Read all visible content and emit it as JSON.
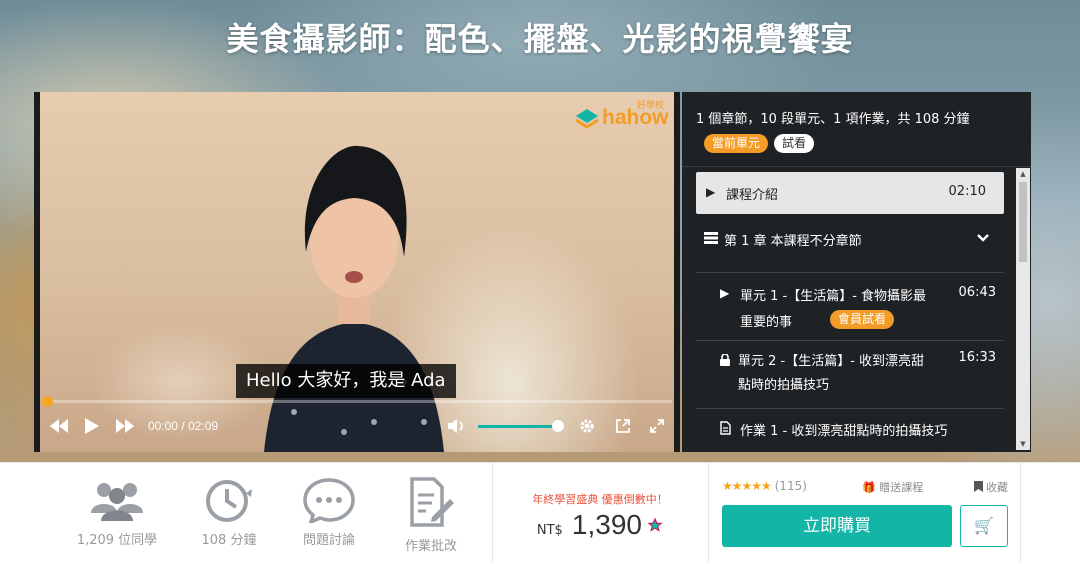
{
  "page": {
    "title": "美食攝影師：配色、擺盤、光影的視覺饗宴"
  },
  "player": {
    "logo_text": "hahow",
    "logo_sub": "好學校",
    "subtitle": "Hello 大家好，我是 Ada",
    "current_time": "00:00",
    "time_separator": "/",
    "total_time": "02:09",
    "progress": 0.0,
    "volume": 1.0
  },
  "outline": {
    "summary": "1 個章節，10 段單元、1 項作業，共 108 分鐘",
    "badge_current": "當前單元",
    "badge_trial": "試看",
    "intro": {
      "label": "課程介紹",
      "duration": "02:10"
    },
    "chapter": {
      "label": "第 1 章 本課程不分章節"
    },
    "unit1": {
      "title_line1": "單元 1 -【生活篇】- 食物攝影最",
      "title_line2": "重要的事",
      "badge": "會員試看",
      "duration": "06:43"
    },
    "unit2": {
      "title_line1": "單元 2 -【生活篇】- 收到漂亮甜",
      "title_line2": "點時的拍攝技巧",
      "duration": "16:33"
    },
    "assignment": {
      "title": "作業 1 - 收到漂亮甜點時的拍攝技巧"
    }
  },
  "stats": {
    "students": "1,209 位同學",
    "minutes": "108 分鐘",
    "discussion": "問題討論",
    "homework": "作業批改"
  },
  "pricing": {
    "promo": "年終學習盛典 優惠倒數中！",
    "currency": "NT$",
    "amount": "1,390"
  },
  "purchase": {
    "stars": "★★★★★",
    "rating_count": "(115)",
    "gift": "贈送課程",
    "favorite": "收藏",
    "buy_label": "立即購買",
    "cart_icon": "🛒"
  },
  "colors": {
    "accent": "#13b5a6",
    "orange": "#f39c27",
    "promo": "#e8533a",
    "panel": "#1f2225"
  }
}
